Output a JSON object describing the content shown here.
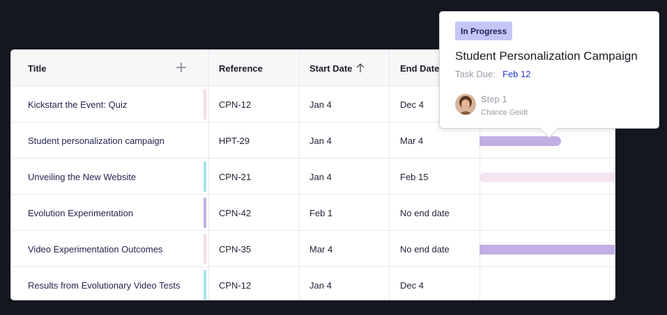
{
  "table": {
    "headers": {
      "title": "Title",
      "reference": "Reference",
      "start_date": "Start Date",
      "end_date": "End Date"
    },
    "rows": [
      {
        "title": "Kickstart the Event: Quiz",
        "reference": "CPN-12",
        "start": "Jan 4",
        "end": "Dec 4",
        "accent": "#f6dbe8"
      },
      {
        "title": "Student personalization campaign",
        "reference": "HPT-29",
        "start": "Jan 4",
        "end": "Mar 4",
        "accent": ""
      },
      {
        "title": "Unveiling the New Website",
        "reference": "CPN-21",
        "start": "Jan 4",
        "end": "Feb 15",
        "accent": "#a6e3ea"
      },
      {
        "title": "Evolution Experimentation",
        "reference": "CPN-42",
        "start": "Feb 1",
        "end": "No end date",
        "accent": "#c2aee3"
      },
      {
        "title": "Video Experimentation Outcomes",
        "reference": "CPN-35",
        "start": "Mar 4",
        "end": "No end date",
        "accent": "#f6dbe8"
      },
      {
        "title": "Results from Evolutionary Video Tests",
        "reference": "CPN-12",
        "start": "Jan 4",
        "end": "Dec 4",
        "accent": "#a6e3ea"
      }
    ]
  },
  "gantt": {
    "bar_colors": {
      "row2": "#a6e3ea",
      "row3": "#c2aee3",
      "row4": "#f6e4f1",
      "row6": "#c2aee3"
    }
  },
  "popover": {
    "status": "In Progress",
    "title": "Student Personalization Campaign",
    "due_label": "Task Due:",
    "due_value": "Feb 12",
    "step": "Step 1",
    "assignee": "Chance Geidt"
  },
  "icons": {
    "add_column": "plus-icon",
    "sort": "arrow-up-icon",
    "avatar": "user-avatar"
  },
  "colors": {
    "background": "#15171f",
    "badge": "#c3c7f7",
    "due_link": "#2b3ad1"
  }
}
